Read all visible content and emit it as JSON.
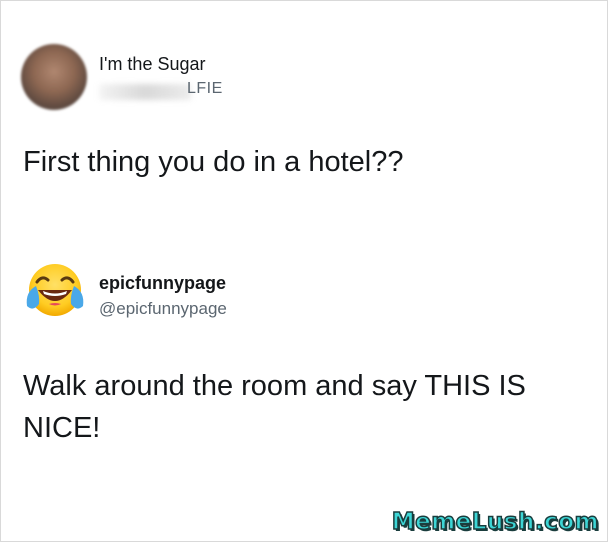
{
  "posts": [
    {
      "author_name": "I'm the Sugar",
      "handle_visible": "LFIE",
      "avatar": "blurred-profile-photo",
      "text": "First thing you do in a hotel??"
    },
    {
      "author_name": "epicfunnypage",
      "handle": "@epicfunnypage",
      "avatar": "face-with-tears-of-joy-emoji",
      "text": "Walk around the room and say THIS IS NICE!"
    }
  ],
  "watermark": {
    "text": "MemeLush.com"
  },
  "colors": {
    "text": "#14171a",
    "handle": "#5b6670",
    "watermark_fill": "#3dd6d6"
  }
}
